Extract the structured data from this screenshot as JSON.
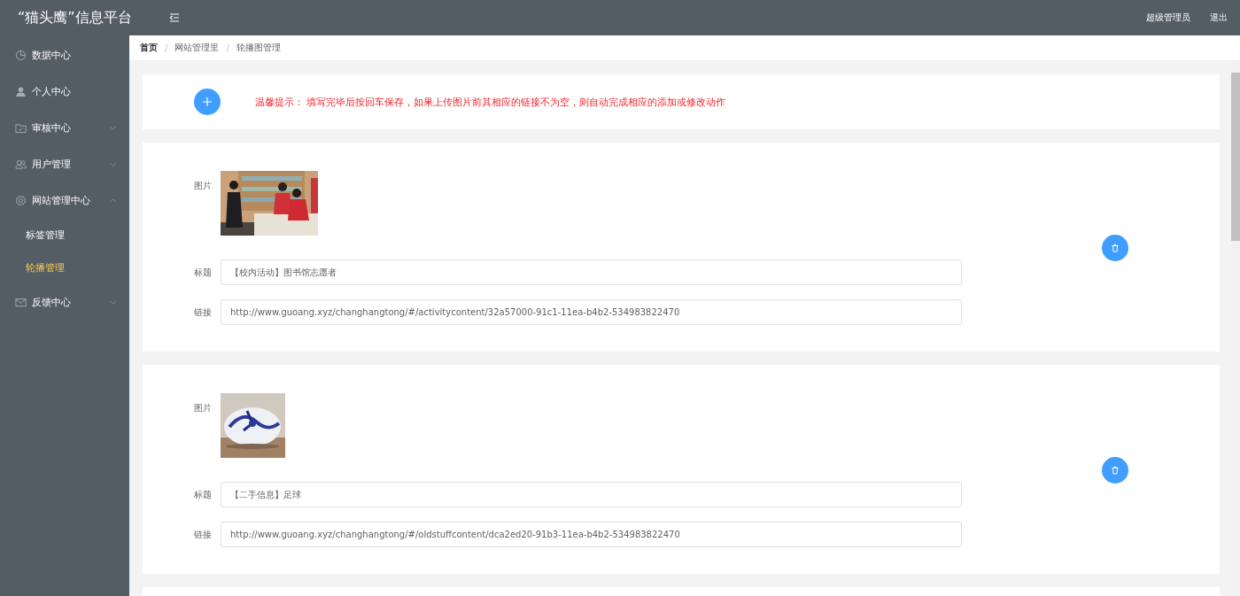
{
  "header": {
    "title": "“猫头鹰”信息平台",
    "user": "超级管理员",
    "logout": "退出"
  },
  "sidebar": {
    "items": [
      {
        "label": "数据中心",
        "kind": "link"
      },
      {
        "label": "个人中心",
        "kind": "link"
      },
      {
        "label": "审核中心",
        "kind": "submenu",
        "expanded": false
      },
      {
        "label": "用户管理",
        "kind": "submenu",
        "expanded": false
      },
      {
        "label": "网站管理中心",
        "kind": "submenu",
        "expanded": true,
        "children": [
          {
            "label": "标签管理",
            "selected": false
          },
          {
            "label": "轮播管理",
            "selected": true
          }
        ]
      },
      {
        "label": "反馈中心",
        "kind": "submenu",
        "expanded": false
      }
    ]
  },
  "breadcrumb": [
    {
      "label": "首页"
    },
    {
      "separator": "/",
      "label": "网站管理里"
    },
    {
      "separator": "/",
      "label": "轮播图管理"
    }
  ],
  "tip": "温馨提示： 填写完毕后按回车保存，如果上传图片前其相应的链接不为空，则自动完成相应的添加或修改动作",
  "slides": [
    {
      "image_label": "图片",
      "title_label": "标题",
      "title": "【校内活动】图书馆志愿者",
      "link_label": "链接",
      "link": "http://www.guoang.xyz/changhangtong/#/activitycontent/32a57000-91c1-11ea-b4b2-534983822470"
    },
    {
      "image_label": "图片",
      "title_label": "标题",
      "title": "【二手信息】足球",
      "link_label": "链接",
      "link": "http://www.guoang.xyz/changhangtong/#/oldstuffcontent/dca2ed20-91b3-11ea-b4b2-534983822470"
    }
  ]
}
